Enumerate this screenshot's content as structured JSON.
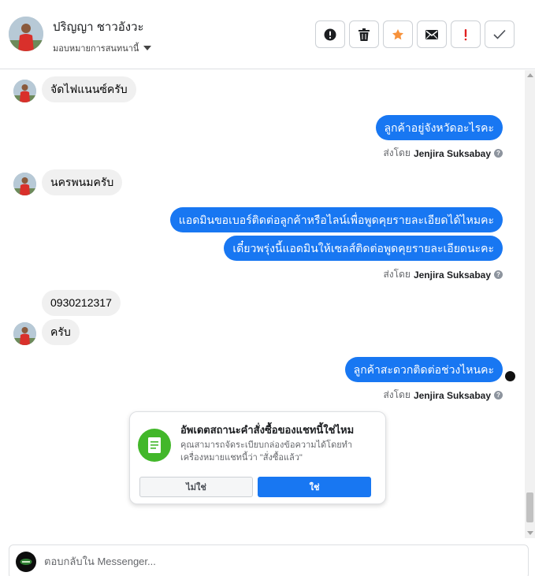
{
  "contact": {
    "name": "ปริญญา ชาวอังวะ",
    "assign_label": "มอบหมายการสนทนานี้"
  },
  "actions": [
    {
      "name": "spam-report",
      "icon": "exclamation-circle-icon"
    },
    {
      "name": "delete",
      "icon": "trash-icon"
    },
    {
      "name": "star",
      "icon": "star-icon",
      "color": "#f7923b"
    },
    {
      "name": "mark-unread",
      "icon": "envelope-icon"
    },
    {
      "name": "follow-up",
      "icon": "exclamation-icon",
      "color": "#e02020"
    },
    {
      "name": "mark-done",
      "icon": "check-icon"
    }
  ],
  "messages": [
    {
      "dir": "in",
      "text": "จัดไฟแนนซ์ครับ"
    },
    {
      "dir": "out",
      "text": "ลูกค้าอยู่จังหวัดอะไรคะ"
    },
    {
      "dir": "in",
      "text": "นครพนมครับ"
    },
    {
      "dir": "out",
      "text": "แอดมินขอเบอร์ติดต่อลูกค้าหรือไลน์เพื่อพูดคุยรายละเอียดได้ไหมคะ"
    },
    {
      "dir": "out",
      "text": "เดี๋ยวพรุ่งนี้แอดมินให้เซลส์ติดต่อพูดคุยรายละเอียดนะคะ"
    },
    {
      "dir": "in",
      "text": "0930212317"
    },
    {
      "dir": "in",
      "text": "ครับ"
    },
    {
      "dir": "out",
      "text": "ลูกค้าสะดวกติดต่อช่วงไหนคะ"
    }
  ],
  "sent_by": {
    "prefix": "ส่งโดย",
    "agent": "Jenjira Suksabay"
  },
  "order_card": {
    "title": "อัพเดตสถานะคำสั่งซื้อของแชทนี้ใช่ไหม",
    "description": "คุณสามารถจัดระเบียบกล่องข้อความได้โดยทำเครื่องหมายแชทนี้ว่า \"สั่งซื้อแล้ว\"",
    "no_label": "ไม่ใช่",
    "yes_label": "ใช่",
    "icon": "receipt-icon",
    "icon_color": "#42b72a"
  },
  "reply": {
    "placeholder": "ตอบกลับใน Messenger..."
  },
  "colors": {
    "outgoing_bubble": "#1877f2",
    "incoming_bubble": "#f0f0f0"
  }
}
